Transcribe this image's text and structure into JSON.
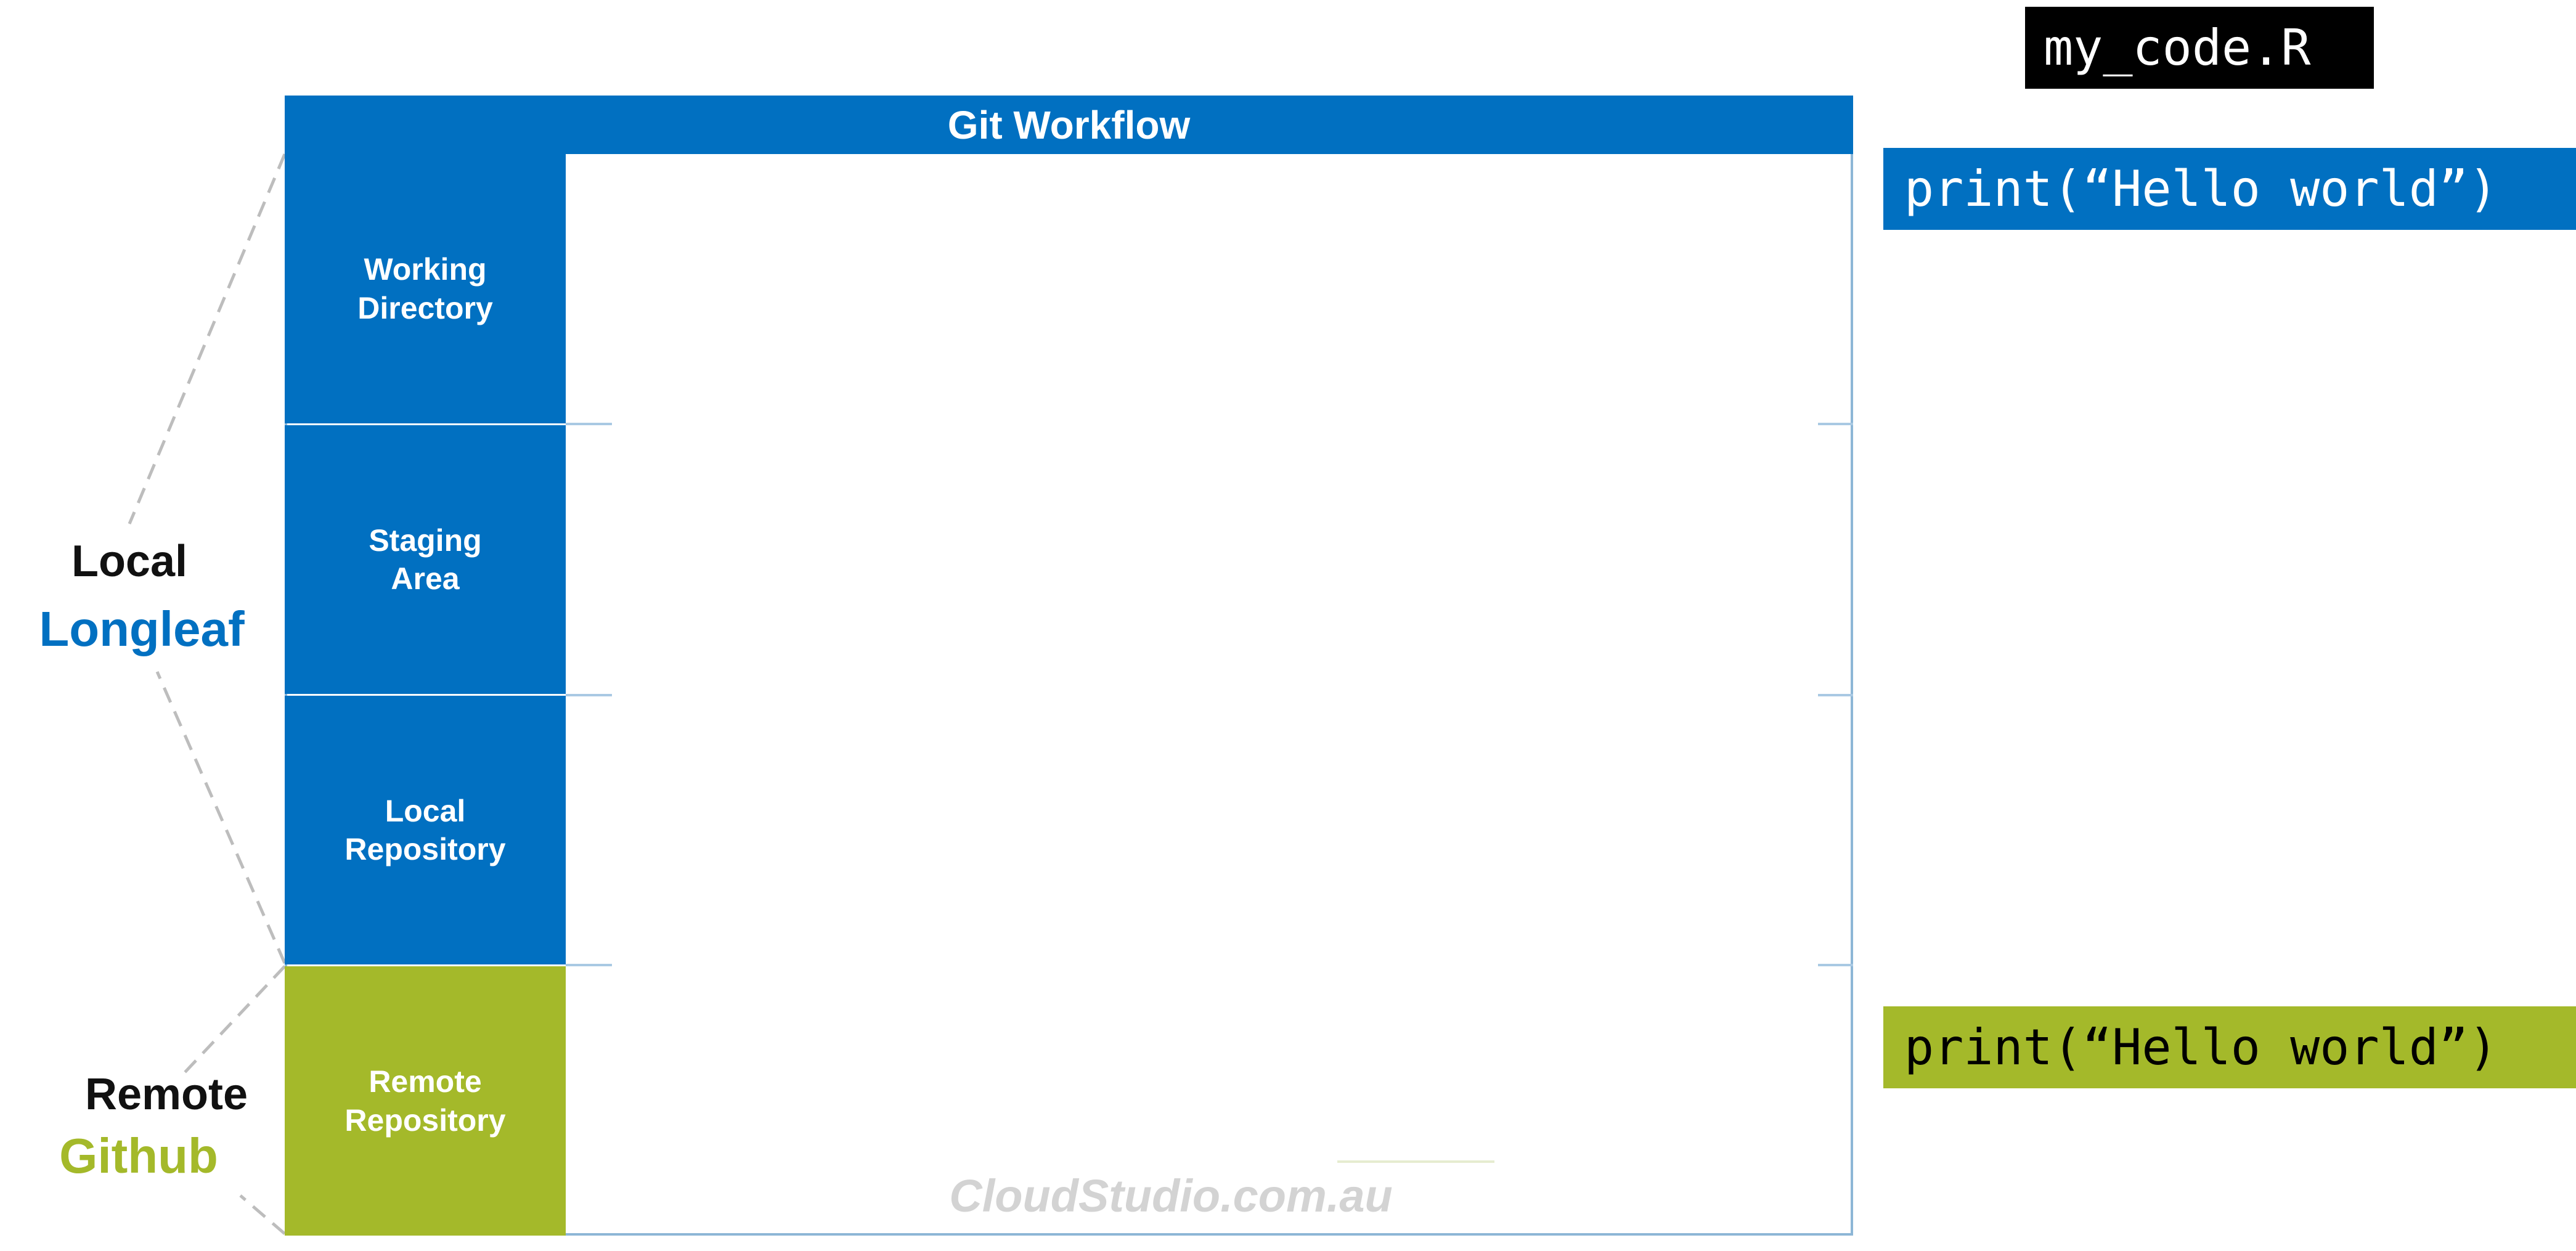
{
  "file_label": "my_code.R",
  "diagram": {
    "title": "Git Workflow",
    "stages": [
      {
        "line1": "Working",
        "line2": "Directory"
      },
      {
        "line1": "Staging",
        "line2": "Area"
      },
      {
        "line1": "Local",
        "line2": "Repository"
      },
      {
        "line1": "Remote",
        "line2": "Repository"
      }
    ],
    "watermark": "CloudStudio.com.au"
  },
  "labels": {
    "local": "Local",
    "local_host": "Longleaf",
    "remote": "Remote",
    "remote_host": "Github"
  },
  "code": {
    "local": "print(“Hello world”)",
    "remote": "print(“Hello world”)"
  },
  "colors": {
    "blue": "#0170c1",
    "green": "#a4b92a"
  }
}
